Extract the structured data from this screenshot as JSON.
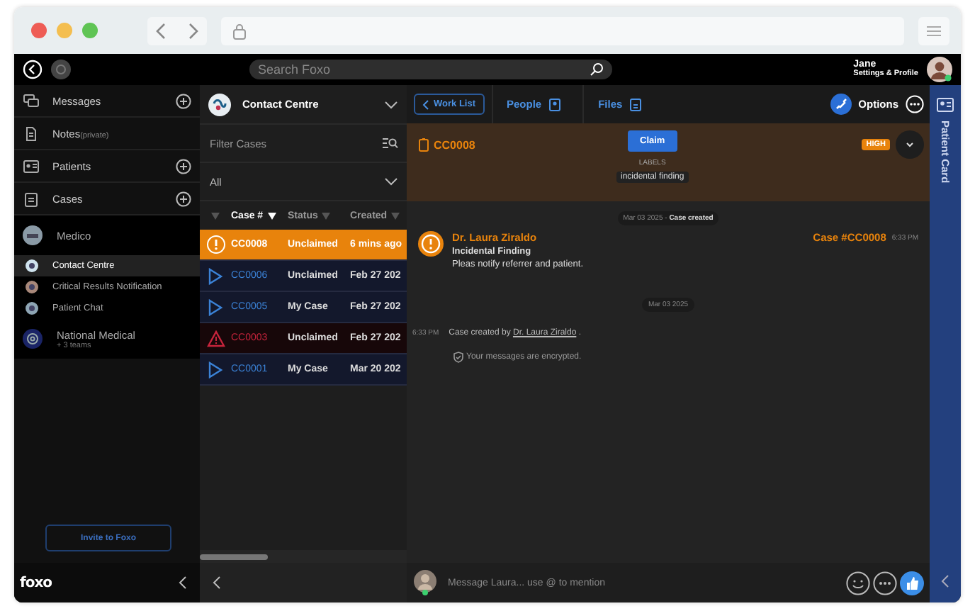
{
  "topbar": {
    "search": {
      "placeholder": "Search Foxo"
    },
    "user": {
      "name": "Jane",
      "subtitle": "Settings & Profile"
    }
  },
  "sidebar": {
    "items": [
      {
        "label": "Messages",
        "add": true
      },
      {
        "label": "Notes",
        "note": "(private)",
        "add": false
      },
      {
        "label": "Patients",
        "add": true
      },
      {
        "label": "Cases",
        "add": true
      }
    ],
    "orgs": [
      {
        "name": "Medico",
        "teams": [
          {
            "name": "Contact Centre",
            "selected": true
          },
          {
            "name": "Critical Results Notification",
            "selected": false
          },
          {
            "name": "Patient Chat",
            "selected": false
          }
        ]
      },
      {
        "name": "National Medical",
        "subtitle": "+ 3 teams"
      }
    ],
    "invite_button": "Invite to Foxo",
    "logo": "foxo"
  },
  "case_list": {
    "team": "Contact Centre",
    "filter": {
      "placeholder": "Filter Cases"
    },
    "view": "All",
    "columns": [
      {
        "label": "Case #",
        "sorted": true
      },
      {
        "label": "Status",
        "sorted": false
      },
      {
        "label": "Created",
        "sorted": false
      }
    ],
    "rows": [
      {
        "kind": "urgent",
        "selected": true,
        "case": "CC0008",
        "status": "Unclaimed",
        "created": "6 mins ago"
      },
      {
        "kind": "open",
        "selected": false,
        "case": "CC0006",
        "status": "Unclaimed",
        "created": "Feb 27 202"
      },
      {
        "kind": "open",
        "selected": false,
        "case": "CC0005",
        "status": "My Case",
        "created": "Feb 27 202"
      },
      {
        "kind": "warning",
        "selected": false,
        "case": "CC0003",
        "status": "Unclaimed",
        "created": "Feb 27 202"
      },
      {
        "kind": "open",
        "selected": false,
        "case": "CC0001",
        "status": "My Case",
        "created": "Mar 20 202"
      }
    ]
  },
  "detail": {
    "toolbar": {
      "back": "Work List",
      "tabs": [
        "People",
        "Files"
      ],
      "options": "Options"
    },
    "case": {
      "id": "CC0008",
      "claim": "Claim",
      "labels_title": "LABELS",
      "labels": [
        "incidental finding"
      ],
      "priority": "HIGH"
    },
    "events": [
      {
        "kind": "date",
        "text": "Mar 03 2025 - **Case created**"
      },
      {
        "kind": "message",
        "author": "Dr. Laura Ziraldo",
        "case_ref": "Case #CC0008",
        "time": "6:33 PM",
        "title": "Incidental Finding",
        "body": "Pleas notify referrer and patient."
      },
      {
        "kind": "date",
        "text": "Mar 03 2025"
      },
      {
        "kind": "system",
        "time": "6:33 PM",
        "text": "Case created by",
        "link": "Dr. Laura Ziraldo",
        "after": "."
      },
      {
        "kind": "note",
        "text": "Your messages are encrypted."
      }
    ],
    "composer": {
      "placeholder": "Message Laura... use @ to mention"
    }
  },
  "patient_card": {
    "label": "Patient Card"
  }
}
